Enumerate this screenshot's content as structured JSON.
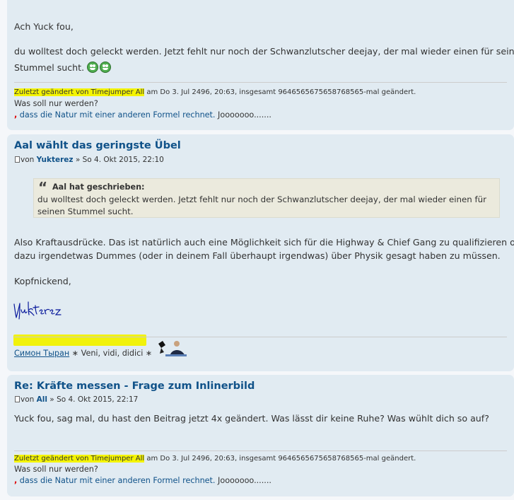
{
  "post1": {
    "greeting": "Ach Yuck fou,",
    "line1": "du wolltest doch geleckt werden. Jetzt fehlt nur noch der Schwanzlutscher deejay, der mal wieder einen für seinen",
    "line2": "Stummel sucht.",
    "edited_highlight": "Zuletzt geändert von Timejumper All",
    "edited_rest": " am Do 3. Jul 2496, 20:63, insgesamt 9646565675658768565-mal geändert.",
    "sig_line1": "Was soll nur werden?",
    "sig_comma": ",",
    "sig_line2": " dass die Natur mit einer anderen Formel rechnet.",
    "sig_tail": " Jooooooo......."
  },
  "post2": {
    "title": "Aal wählt das geringste Übel",
    "by": "von",
    "author": "Yukterez",
    "date": " » So 4. Okt 2015, 22:10",
    "quote_author": "Aal hat geschrieben:",
    "quote_text": "du wolltest doch geleckt werden. Jetzt fehlt nur noch der Schwanzlutscher deejay, der mal wieder einen für seinen Stummel sucht.",
    "body1": "Also Kraftausdrücke. Das ist natürlich auch eine Möglichkeit sich für die Highway & Chief Gang zu qualifizieren ohne",
    "body2": "dazu irgendetwas Dummes (oder in deinem Fall überhaupt irgendwas) über Physik gesagt haben zu müssen.",
    "closing": "Kopfnickend,",
    "signature_name": "Yukterez",
    "sig_link": "Симон Тыран",
    "sig_motto": " ∗ Veni, vidi, didici ∗"
  },
  "post3": {
    "title": "Re: Kräfte messen - Frage zum Inlinerbild",
    "by": "von",
    "author": "All",
    "date": " » So 4. Okt 2015, 22:17",
    "body": "Yuck fou, sag mal, du hast den Beitrag jetzt 4x geändert. Was lässt dir keine Ruhe? Was wühlt dich so auf?",
    "edited_highlight": "Zuletzt geändert von Timejumper All",
    "edited_rest": " am Do 3. Jul 2496, 20:63, insgesamt 9646565675658768565-mal geändert.",
    "sig_line1": "Was soll nur werden?",
    "sig_comma": ",",
    "sig_line2": " dass die Natur mit einer anderen Formel rechnet.",
    "sig_tail": " Jooooooo......."
  }
}
